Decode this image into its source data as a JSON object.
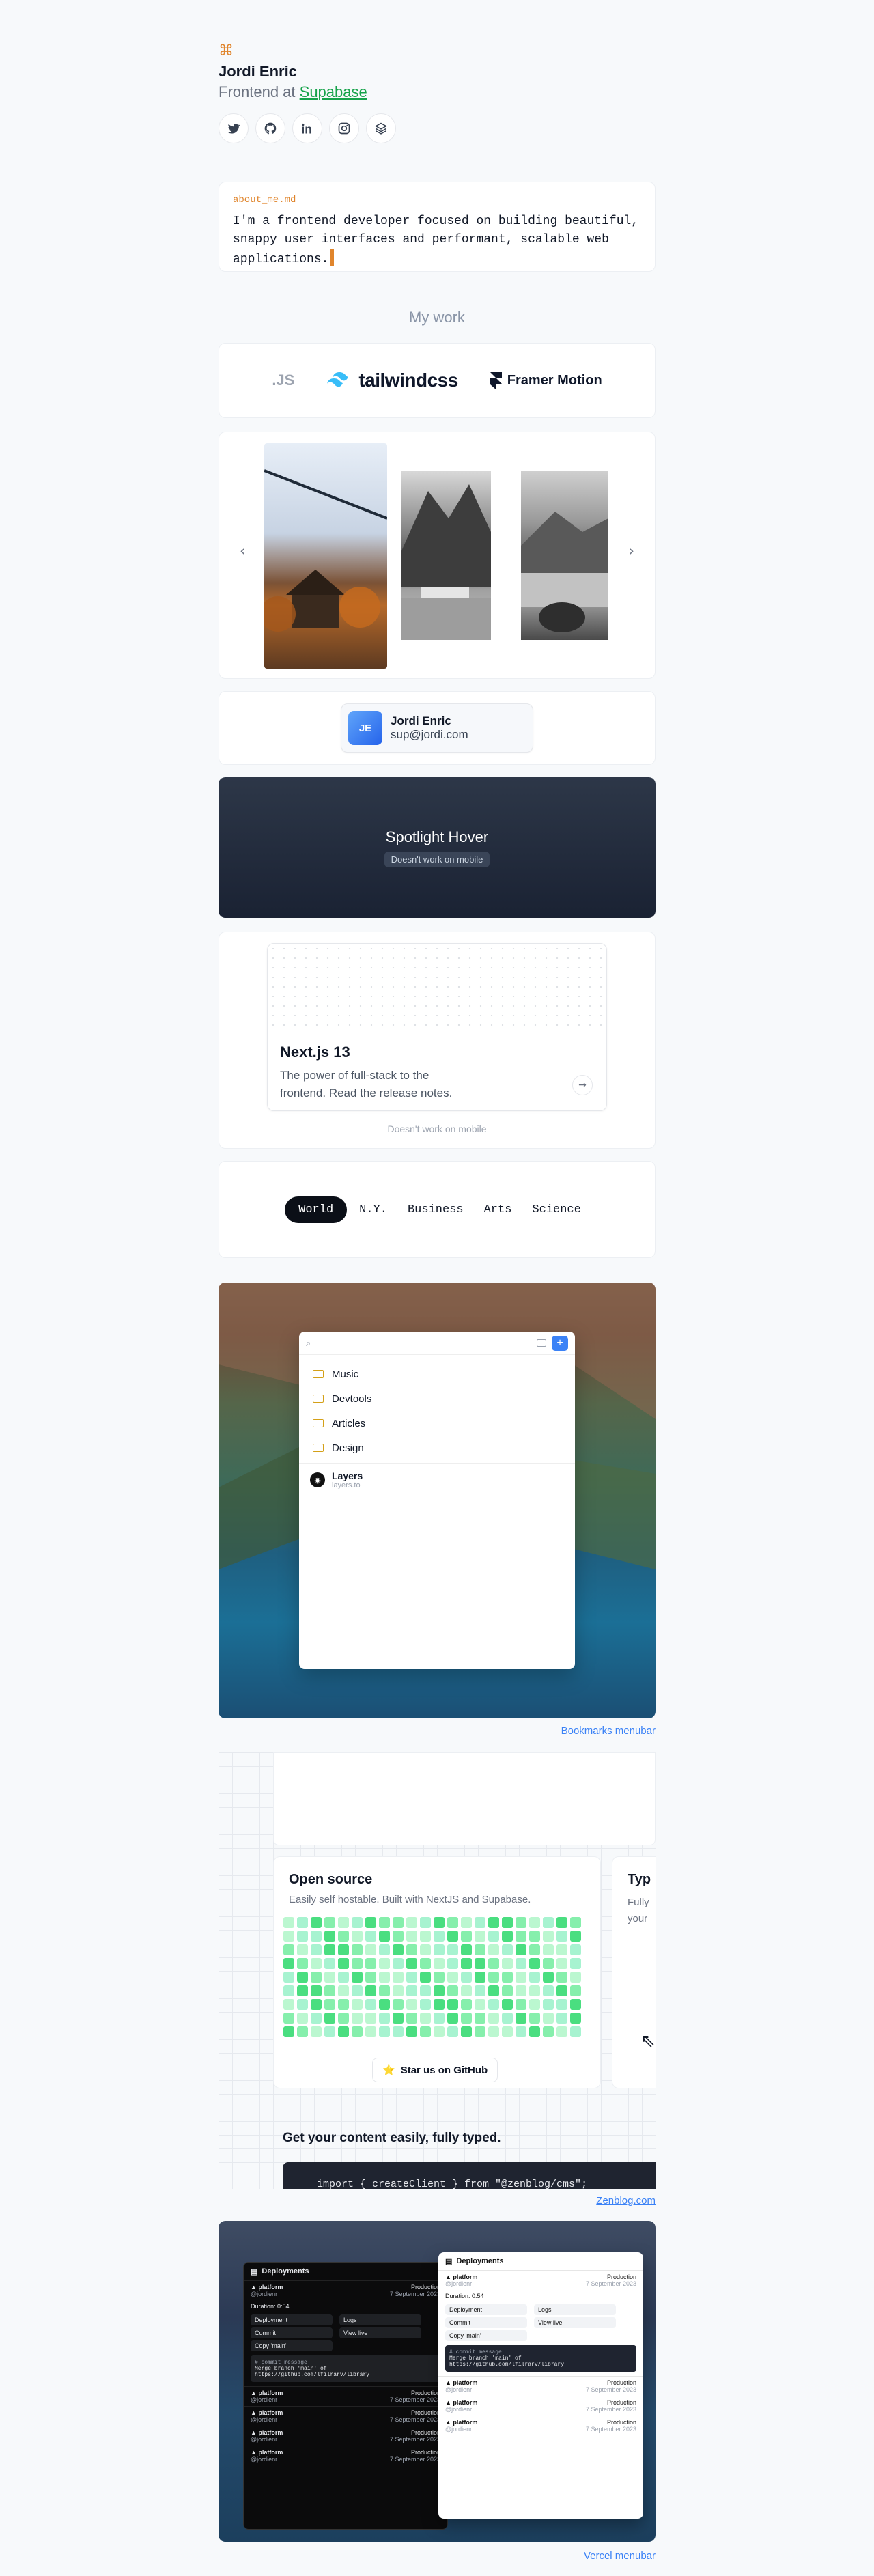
{
  "header": {
    "name": "Jordi Enric",
    "role_prefix": "Frontend at",
    "company": "Supabase",
    "logo_glyph": "⌘"
  },
  "socials": [
    {
      "icon": "twitter-icon"
    },
    {
      "icon": "github-icon"
    },
    {
      "icon": "linkedin-icon"
    },
    {
      "icon": "instagram-icon"
    },
    {
      "icon": "layers-icon"
    }
  ],
  "about": {
    "filename": "about_me.md",
    "text": "I'm a frontend developer focused on building beautiful, snappy user interfaces and performant, scalable web applications."
  },
  "section_title": "My work",
  "logos": {
    "next": ".JS",
    "tailwind": "tailwindcss",
    "framer": "Framer Motion"
  },
  "carousel": {
    "prev": "‹",
    "next": "›"
  },
  "contact": {
    "initials": "JE",
    "name": "Jordi Enric",
    "email": "sup@jordi.com"
  },
  "spotlight": {
    "title": "Spotlight Hover",
    "note": "Doesn't work on mobile"
  },
  "nextjs_card": {
    "title": "Next.js 13",
    "description": "The power of full-stack to the frontend. Read the release notes.",
    "note": "Doesn't work on mobile"
  },
  "tabs": [
    {
      "label": "World",
      "active": true
    },
    {
      "label": "N.Y.",
      "active": false
    },
    {
      "label": "Business",
      "active": false
    },
    {
      "label": "Arts",
      "active": false
    },
    {
      "label": "Science",
      "active": false
    }
  ],
  "bookmarks": {
    "plus": "+",
    "folders": [
      "Music",
      "Devtools",
      "Articles",
      "Design"
    ],
    "item": {
      "name": "Layers",
      "url": "layers.to"
    },
    "caption": "Bookmarks menubar"
  },
  "zenblog": {
    "open_source_title": "Open source",
    "open_source_sub": "Easily self hostable. Built with NextJS and Supabase.",
    "star_button": "Star us on GitHub",
    "typed_title": "Typ",
    "typed_sub_1": "Fully",
    "typed_sub_2": "your",
    "get_content": "Get your content easily, fully typed.",
    "code": "import { createClient } from \"@zenblog/cms\";",
    "caption": "Zenblog.com"
  },
  "vercel": {
    "title": "Deployments",
    "project": "platform",
    "env": "Production",
    "date": "7 September 2023",
    "author": "@jordienr",
    "duration": "Duration: 0:54",
    "actions": [
      "Deployment",
      "Logs",
      "Commit",
      "View live",
      "Copy 'main'"
    ],
    "commit_label": "# commit message",
    "commit_text": "Merge branch 'main' of https://github.com/lfilrarv/library",
    "caption": "Vercel menubar"
  }
}
